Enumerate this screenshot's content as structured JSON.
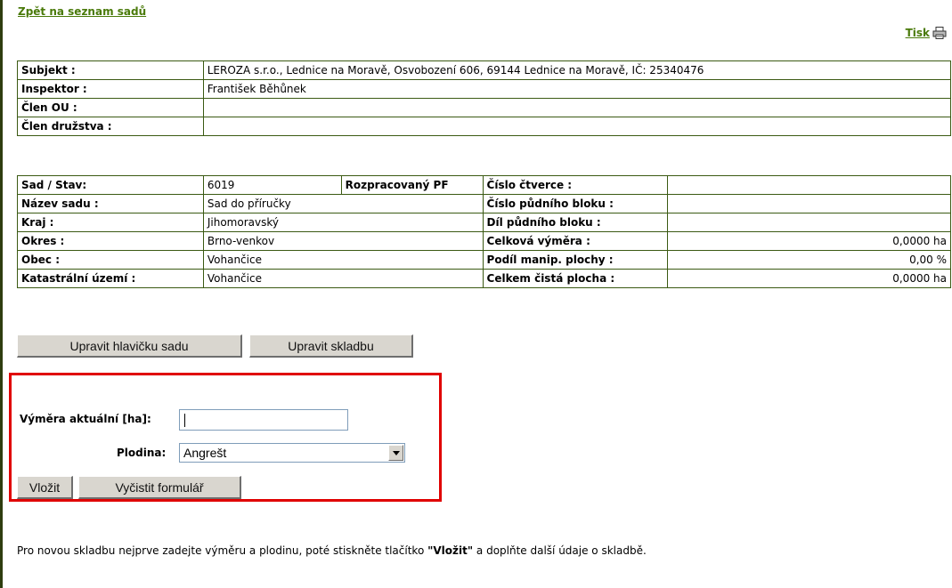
{
  "header": {
    "back_link": "Zpět na seznam sadů",
    "print_link": "Tisk",
    "print_icon": "printer-icon"
  },
  "people": [
    {
      "label": "Subjekt :",
      "value": "LEROZA s.r.o., Lednice na Moravě, Osvobození 606, 69144 Lednice na Moravě, IČ: 25340476"
    },
    {
      "label": "Inspektor :",
      "value": "František Běhůnek"
    },
    {
      "label": "Člen OU :",
      "value": ""
    },
    {
      "label": "Člen družstva :",
      "value": ""
    }
  ],
  "orchard": {
    "rows": [
      {
        "l1": "Sad / Stav:",
        "v1": "6019",
        "status": "Rozpracovaný PF",
        "l2": "Číslo čtverce :",
        "v2": ""
      },
      {
        "l1": "Název sadu :",
        "v1": "Sad do příručky",
        "l2": "Číslo půdního bloku :",
        "v2": ""
      },
      {
        "l1": "Kraj :",
        "v1": "Jihomoravský",
        "l2": "Díl půdního bloku :",
        "v2": ""
      },
      {
        "l1": "Okres :",
        "v1": "Brno-venkov",
        "l2": "Celková výměra :",
        "v2": "0,0000 ha"
      },
      {
        "l1": "Obec :",
        "v1": "Vohančice",
        "l2": "Podíl manip. plochy :",
        "v2": "0,00 %"
      },
      {
        "l1": "Katastrální území :",
        "v1": "Vohančice",
        "l2": "Celkem čistá plocha :",
        "v2": "0,0000 ha"
      }
    ]
  },
  "buttons": {
    "edit_header": "Upravit hlavičku sadu",
    "edit_composition": "Upravit skladbu",
    "insert": "Vložit",
    "clear_form": "Vyčistit formulář"
  },
  "form": {
    "area_label": "Výměra aktuální [ha]:",
    "area_value": "",
    "crop_label": "Plodina:",
    "crop_value": "Angrešt"
  },
  "note": {
    "before": "Pro novou skladbu nejprve zadejte výměru a plodinu, poté stiskněte tlačítko ",
    "bold": "\"Vložit\"",
    "after": " a doplňte další údaje o skladbě."
  },
  "colors": {
    "link": "#4a7a0a",
    "border": "#3b5a13",
    "highlight": "#e00000"
  }
}
